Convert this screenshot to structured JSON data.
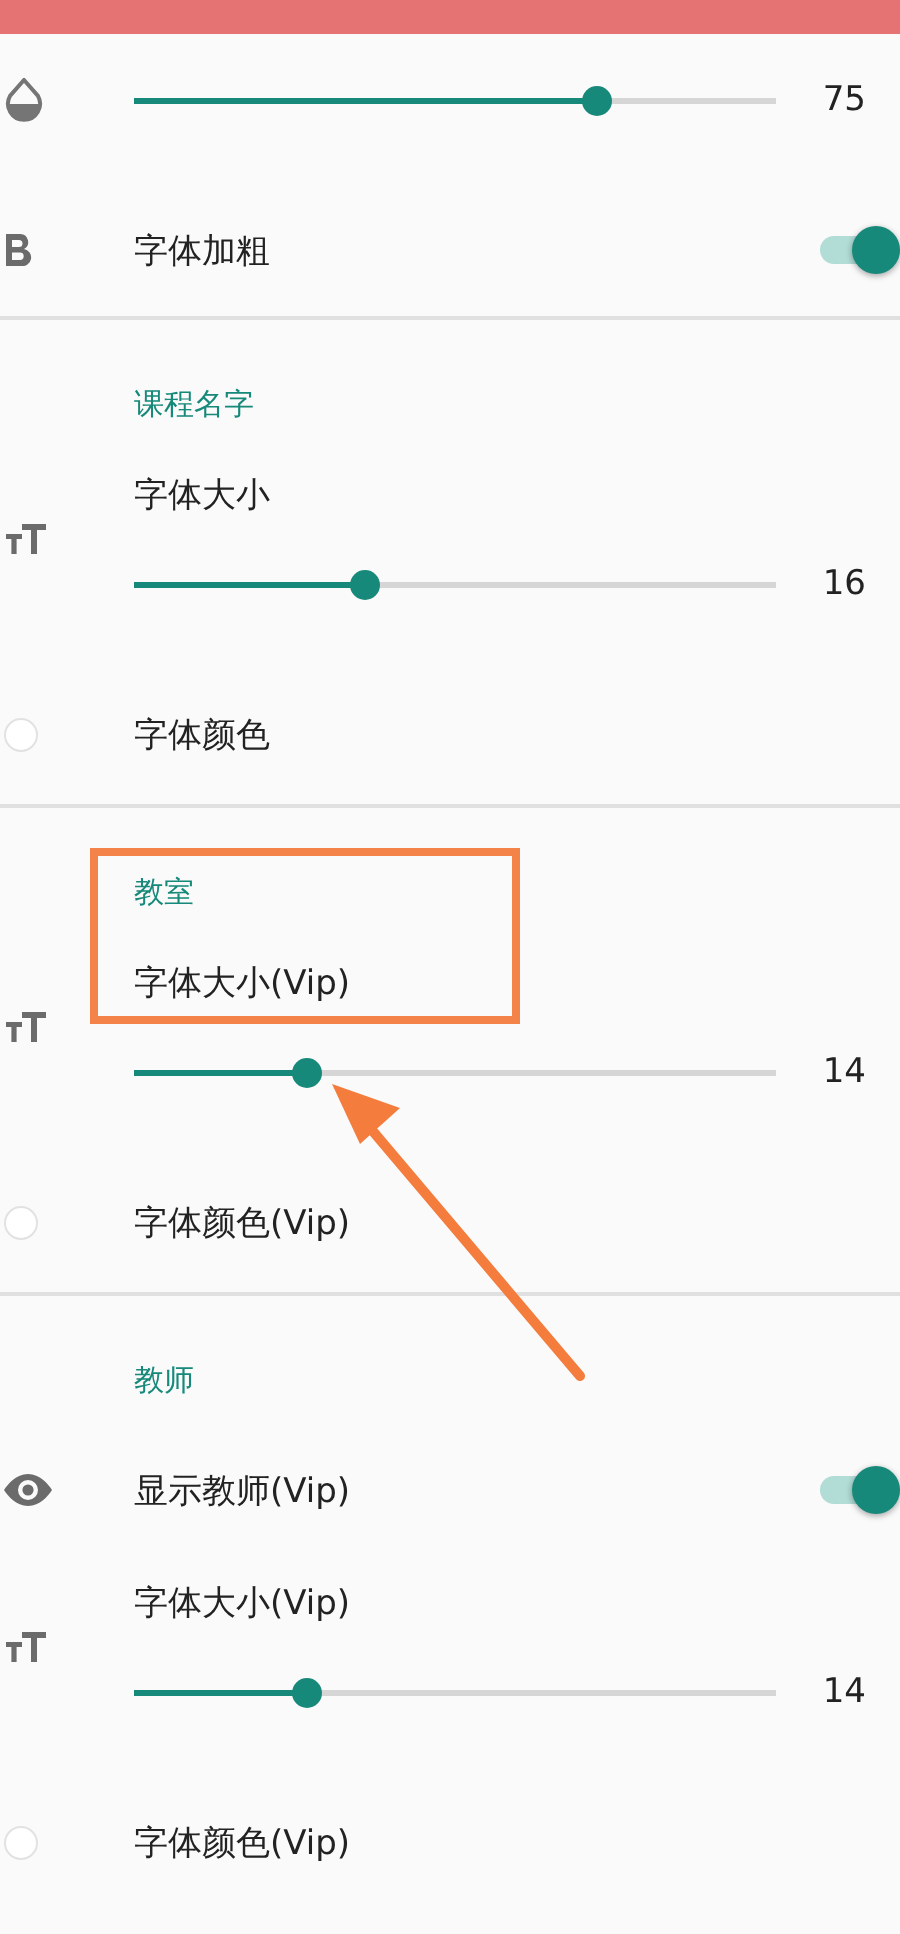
{
  "sections": [
    {
      "rows": [
        {
          "kind": "opacity",
          "level": 0.72,
          "value": "75"
        },
        {
          "kind": "bold-toggle",
          "label": "字体加粗",
          "on": true
        }
      ]
    },
    {
      "header": "课程名字",
      "rows": [
        {
          "kind": "size",
          "label": "字体大小",
          "level": 0.36,
          "value": "16"
        },
        {
          "kind": "color",
          "label": "字体颜色",
          "color": "#ffffff"
        }
      ]
    },
    {
      "header": "教室",
      "highlighted": true,
      "rows": [
        {
          "kind": "size",
          "label": "字体大小(Vip)",
          "level": 0.27,
          "value": "14"
        },
        {
          "kind": "color",
          "label": "字体颜色(Vip)",
          "color": "#ffffff"
        }
      ]
    },
    {
      "header": "教师",
      "rows": [
        {
          "kind": "show-toggle",
          "label": "显示教师(Vip)",
          "on": true
        },
        {
          "kind": "size",
          "label": "字体大小(Vip)",
          "level": 0.27,
          "value": "14"
        },
        {
          "kind": "color",
          "label": "字体颜色(Vip)",
          "color": "#ffffff"
        }
      ]
    }
  ]
}
